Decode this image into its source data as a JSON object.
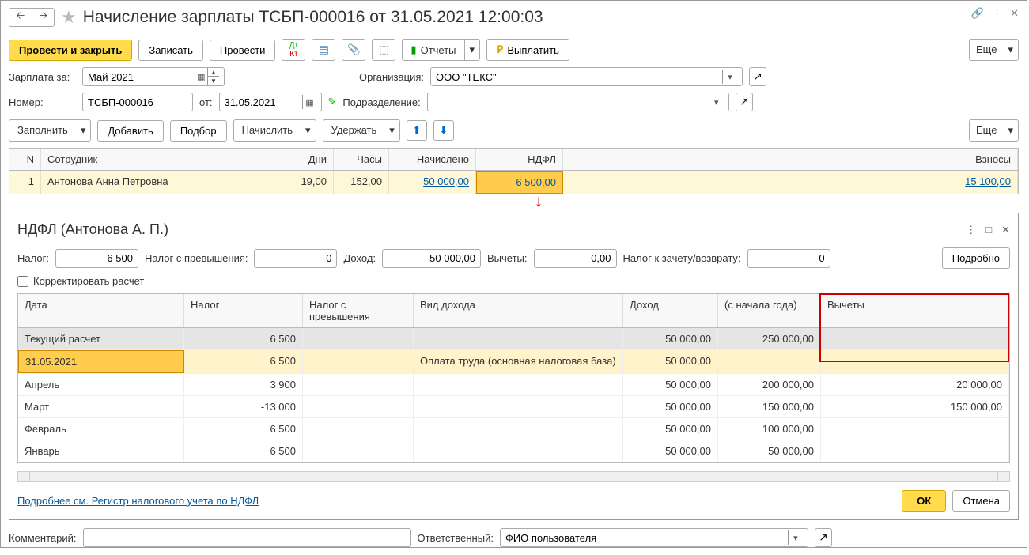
{
  "title": "Начисление зарплаты ТСБП-000016 от 31.05.2021 12:00:03",
  "nav": {
    "back": "🡐",
    "fwd": "🡒"
  },
  "toolbar": {
    "post_close": "Провести и закрыть",
    "save": "Записать",
    "post": "Провести",
    "reports": "Отчеты",
    "pay": "Выплатить",
    "more": "Еще"
  },
  "fields": {
    "salary_for_label": "Зарплата за:",
    "salary_for": "Май 2021",
    "org_label": "Организация:",
    "org": "ООО \"ТЕКС\"",
    "num_label": "Номер:",
    "num": "ТСБП-000016",
    "date_label": "от:",
    "date": "31.05.2021",
    "dept_label": "Подразделение:",
    "dept": ""
  },
  "toolbar2": {
    "fill": "Заполнить",
    "add": "Добавить",
    "pick": "Подбор",
    "accrue": "Начислить",
    "withhold": "Удержать",
    "more": "Еще"
  },
  "grid": {
    "headers": {
      "n": "N",
      "emp": "Сотрудник",
      "days": "Дни",
      "hours": "Часы",
      "acc": "Начислено",
      "ndfl": "НДФЛ",
      "contr": "Взносы"
    },
    "rows": [
      {
        "n": "1",
        "emp": "Антонова Анна Петровна",
        "days": "19,00",
        "hours": "152,00",
        "acc": "50 000,00",
        "ndfl": "6 500,00",
        "contr": "15 100,00"
      }
    ]
  },
  "panel": {
    "title": "НДФЛ (Антонова А. П.)",
    "tax_label": "Налог:",
    "tax": "6 500",
    "tax_excess_label": "Налог с превышения:",
    "tax_excess": "0",
    "income_label": "Доход:",
    "income": "50 000,00",
    "ded_label": "Вычеты:",
    "ded": "0,00",
    "tax_credit_label": "Налог к зачету/возврату:",
    "tax_credit": "0",
    "details_btn": "Подробно",
    "correct_label": "Корректировать расчет",
    "link": "Подробнее см. Регистр налогового учета по НДФЛ",
    "ok": "ОК",
    "cancel": "Отмена"
  },
  "dtable": {
    "headers": {
      "date": "Дата",
      "tax": "Налог",
      "tax_excess": "Налог с превышения",
      "inc_type": "Вид дохода",
      "inc": "Доход",
      "year": "(с начала года)",
      "ded": "Вычеты"
    },
    "rows": [
      {
        "date": "Текущий расчет",
        "tax": "6 500",
        "tax_excess": "",
        "inc_type": "",
        "inc": "50 000,00",
        "year": "250 000,00",
        "ded": "",
        "cls": "total"
      },
      {
        "date": "31.05.2021",
        "tax": "6 500",
        "tax_excess": "",
        "inc_type": "Оплата труда (основная налоговая база)",
        "inc": "50 000,00",
        "year": "",
        "ded": "",
        "cls": "selected"
      },
      {
        "date": "Апрель",
        "tax": "3 900",
        "tax_excess": "",
        "inc_type": "",
        "inc": "50 000,00",
        "year": "200 000,00",
        "ded": "20 000,00",
        "cls": ""
      },
      {
        "date": "Март",
        "tax": "-13 000",
        "tax_excess": "",
        "inc_type": "",
        "inc": "50 000,00",
        "year": "150 000,00",
        "ded": "150 000,00",
        "cls": ""
      },
      {
        "date": "Февраль",
        "tax": "6 500",
        "tax_excess": "",
        "inc_type": "",
        "inc": "50 000,00",
        "year": "100 000,00",
        "ded": "",
        "cls": ""
      },
      {
        "date": "Январь",
        "tax": "6 500",
        "tax_excess": "",
        "inc_type": "",
        "inc": "50 000,00",
        "year": "50 000,00",
        "ded": "",
        "cls": ""
      }
    ]
  },
  "footer": {
    "comment_label": "Комментарий:",
    "comment": "",
    "resp_label": "Ответственный:",
    "resp": "ФИО пользователя"
  }
}
